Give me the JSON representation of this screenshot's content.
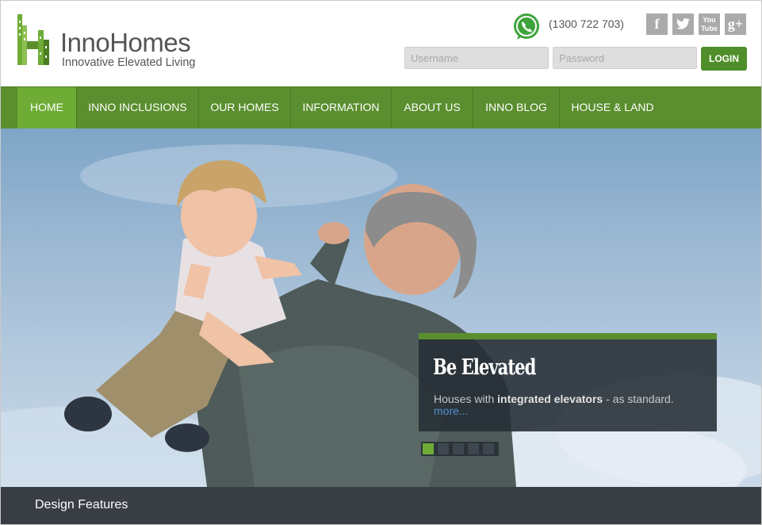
{
  "header": {
    "brand_name": "InnoHomes",
    "brand_tagline": "Innovative Elevated Living",
    "phone": "(1300 722 703)",
    "social": [
      {
        "icon": "facebook-icon",
        "glyph": "f"
      },
      {
        "icon": "twitter-icon",
        "glyph": "t"
      },
      {
        "icon": "youtube-icon",
        "glyph": "You Tube"
      },
      {
        "icon": "google-plus-icon",
        "glyph": "g+"
      }
    ],
    "login": {
      "username_placeholder": "Username",
      "password_placeholder": "Password",
      "button_label": "LOGIN"
    }
  },
  "nav": {
    "items": [
      {
        "label": "HOME",
        "active": true
      },
      {
        "label": "INNO INCLUSIONS",
        "active": false
      },
      {
        "label": "OUR HOMES",
        "active": false
      },
      {
        "label": "INFORMATION",
        "active": false
      },
      {
        "label": "ABOUT US",
        "active": false
      },
      {
        "label": "INNO BLOG",
        "active": false
      },
      {
        "label": "HOUSE & LAND",
        "active": false
      }
    ]
  },
  "hero": {
    "caption_title": "Be Elevated",
    "caption_text_before": "Houses with ",
    "caption_text_bold": "integrated elevators",
    "caption_text_after": " - as standard.",
    "caption_link": "more...",
    "slides_total": 5,
    "slide_active": 1
  },
  "features": {
    "title": "Design Features"
  },
  "colors": {
    "brand_green": "#5a8e2e",
    "nav_active": "#6eac36",
    "caption_bg": "#262d34",
    "features_bg": "#393e45",
    "link_blue": "#4d8fd1"
  }
}
